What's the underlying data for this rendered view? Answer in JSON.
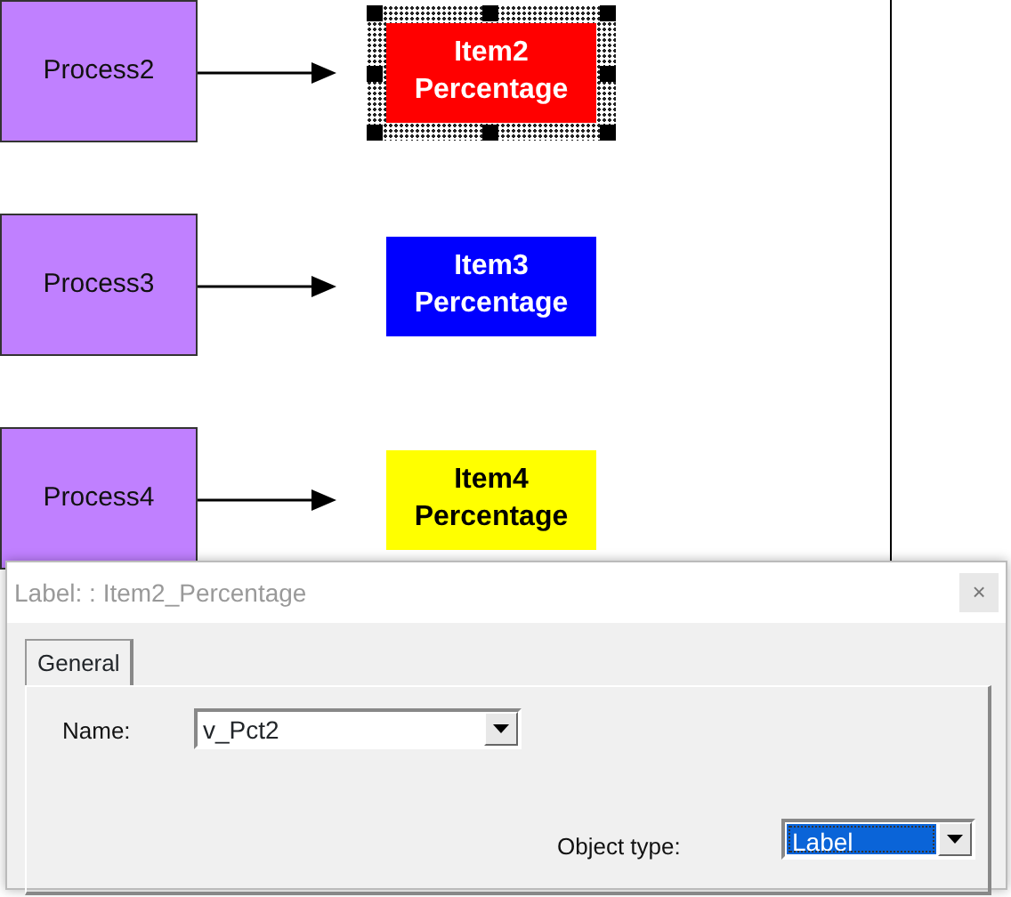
{
  "diagram": {
    "rows": [
      {
        "process": "Process2",
        "label": "Item2\nPercentage",
        "color": "#ff0000",
        "selected": true
      },
      {
        "process": "Process3",
        "label": "Item3\nPercentage",
        "color": "#0000ff",
        "selected": false
      },
      {
        "process": "Process4",
        "label": "Item4\nPercentage",
        "color": "#ffff00",
        "selected": false
      }
    ]
  },
  "dialog": {
    "title": "Label: : Item2_Percentage",
    "close": "×",
    "tabs": [
      {
        "label": "General",
        "selected": true
      }
    ],
    "fields": [
      {
        "label": "Name:",
        "value": "v_Pct2",
        "highlighted": false
      },
      {
        "label": "Object type:",
        "value": "Label",
        "highlighted": true
      }
    ]
  }
}
